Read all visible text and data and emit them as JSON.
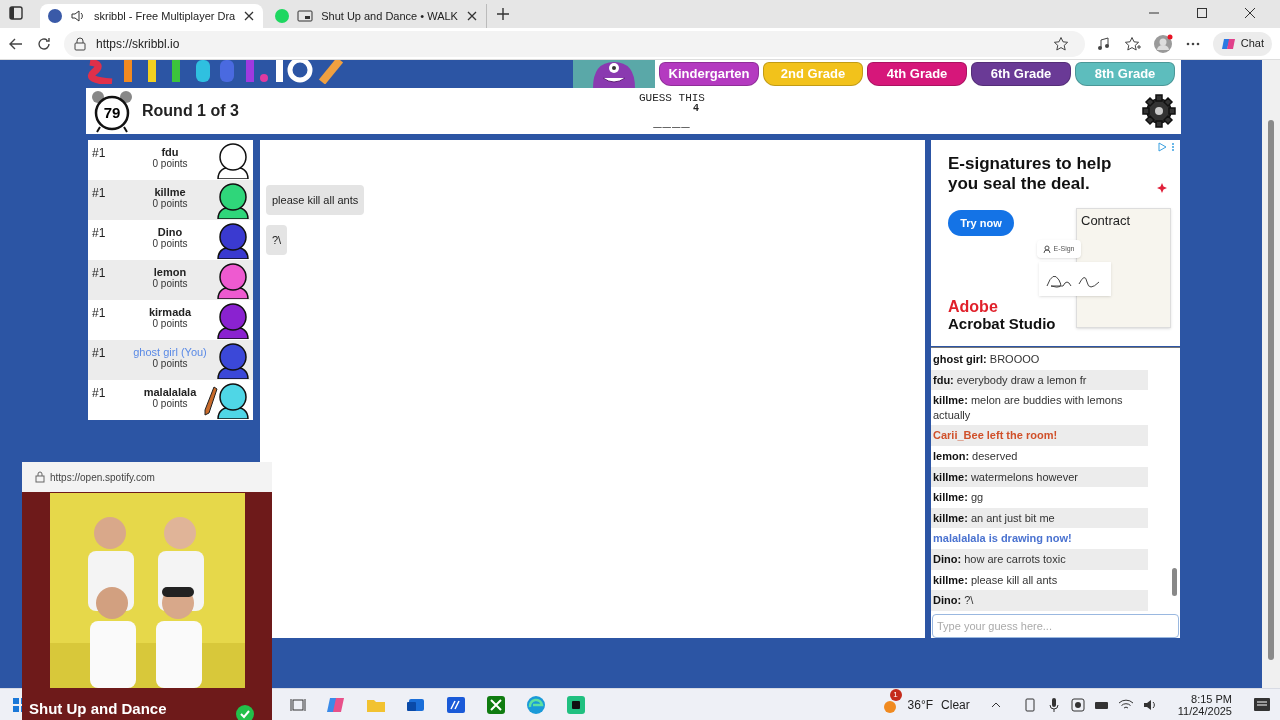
{
  "browser": {
    "tabs": [
      {
        "title": "skribbl - Free Multiplayer Dra",
        "selected": true,
        "audio": true
      },
      {
        "title": "Shut Up and Dance • WALK",
        "selected": false,
        "audio": false
      }
    ],
    "url": "https://skribbl.io",
    "chat_button": "Chat"
  },
  "top_ad": {
    "grades": [
      {
        "label": "Kindergarten",
        "color": "#b43ac0"
      },
      {
        "label": "2nd Grade",
        "color": "#f2c21b"
      },
      {
        "label": "4th Grade",
        "color": "#d6177a"
      },
      {
        "label": "6th Grade",
        "color": "#6a3a96"
      },
      {
        "label": "8th Grade",
        "color": "#5dbdbd"
      }
    ]
  },
  "header": {
    "timer": "79",
    "round": "Round 1 of 3",
    "hint_label": "GUESS THIS",
    "hint_count": "4",
    "hint": "____"
  },
  "players": [
    {
      "rank": "#1",
      "name": "fdu",
      "points": "0 points",
      "you": false,
      "color": "#ffffff",
      "drawing": false
    },
    {
      "rank": "#1",
      "name": "killme",
      "points": "0 points",
      "you": false,
      "color": "#2fd67a",
      "drawing": false,
      "bubble": "please kill all ants"
    },
    {
      "rank": "#1",
      "name": "Dino",
      "points": "0 points",
      "you": false,
      "color": "#3a3ad0",
      "drawing": false,
      "bubble": "?\\"
    },
    {
      "rank": "#1",
      "name": "lemon",
      "points": "0 points",
      "you": false,
      "color": "#ee5ad0",
      "drawing": false
    },
    {
      "rank": "#1",
      "name": "kirmada",
      "points": "0 points",
      "you": false,
      "color": "#8a22d0",
      "drawing": false
    },
    {
      "rank": "#1",
      "name": "ghost girl (You)",
      "points": "0 points",
      "you": true,
      "color": "#3b48d8",
      "drawing": false
    },
    {
      "rank": "#1",
      "name": "malalalala",
      "points": "0 points",
      "you": false,
      "color": "#4fd6e6",
      "drawing": true
    }
  ],
  "ad": {
    "headline": "E-signatures to help you seal the deal.",
    "button": "Try now",
    "contract": "Contract",
    "esign": "E-Sign",
    "brand": "Adobe",
    "product": "Acrobat Studio"
  },
  "chat": {
    "messages": [
      {
        "kind": "message",
        "author": "ghost girl:",
        "text": "BROOOO"
      },
      {
        "kind": "message",
        "author": "fdu:",
        "text": "everybody draw a lemon fr"
      },
      {
        "kind": "message",
        "author": "killme:",
        "text": "melon are buddies with lemons actually"
      },
      {
        "kind": "leave",
        "text": "Carii_Bee left the room!"
      },
      {
        "kind": "message",
        "author": "lemon:",
        "text": "deserved"
      },
      {
        "kind": "message",
        "author": "killme:",
        "text": "watermelons however"
      },
      {
        "kind": "message",
        "author": "killme:",
        "text": "gg"
      },
      {
        "kind": "message",
        "author": "killme:",
        "text": "an ant just bit me"
      },
      {
        "kind": "drawing",
        "text": "malalalala is drawing now!"
      },
      {
        "kind": "message",
        "author": "Dino:",
        "text": "how are carrots toxic"
      },
      {
        "kind": "message",
        "author": "killme:",
        "text": "please kill all ants"
      },
      {
        "kind": "message",
        "author": "Dino:",
        "text": "?\\"
      }
    ],
    "placeholder": "Type your guess here..."
  },
  "media_popup": {
    "url": "https://open.spotify.com",
    "title": "Shut Up and Dance"
  },
  "taskbar": {
    "weather_badge": "1",
    "temperature": "36°F",
    "weather": "Clear",
    "time": "8:15 PM",
    "date": "11/24/2025"
  }
}
